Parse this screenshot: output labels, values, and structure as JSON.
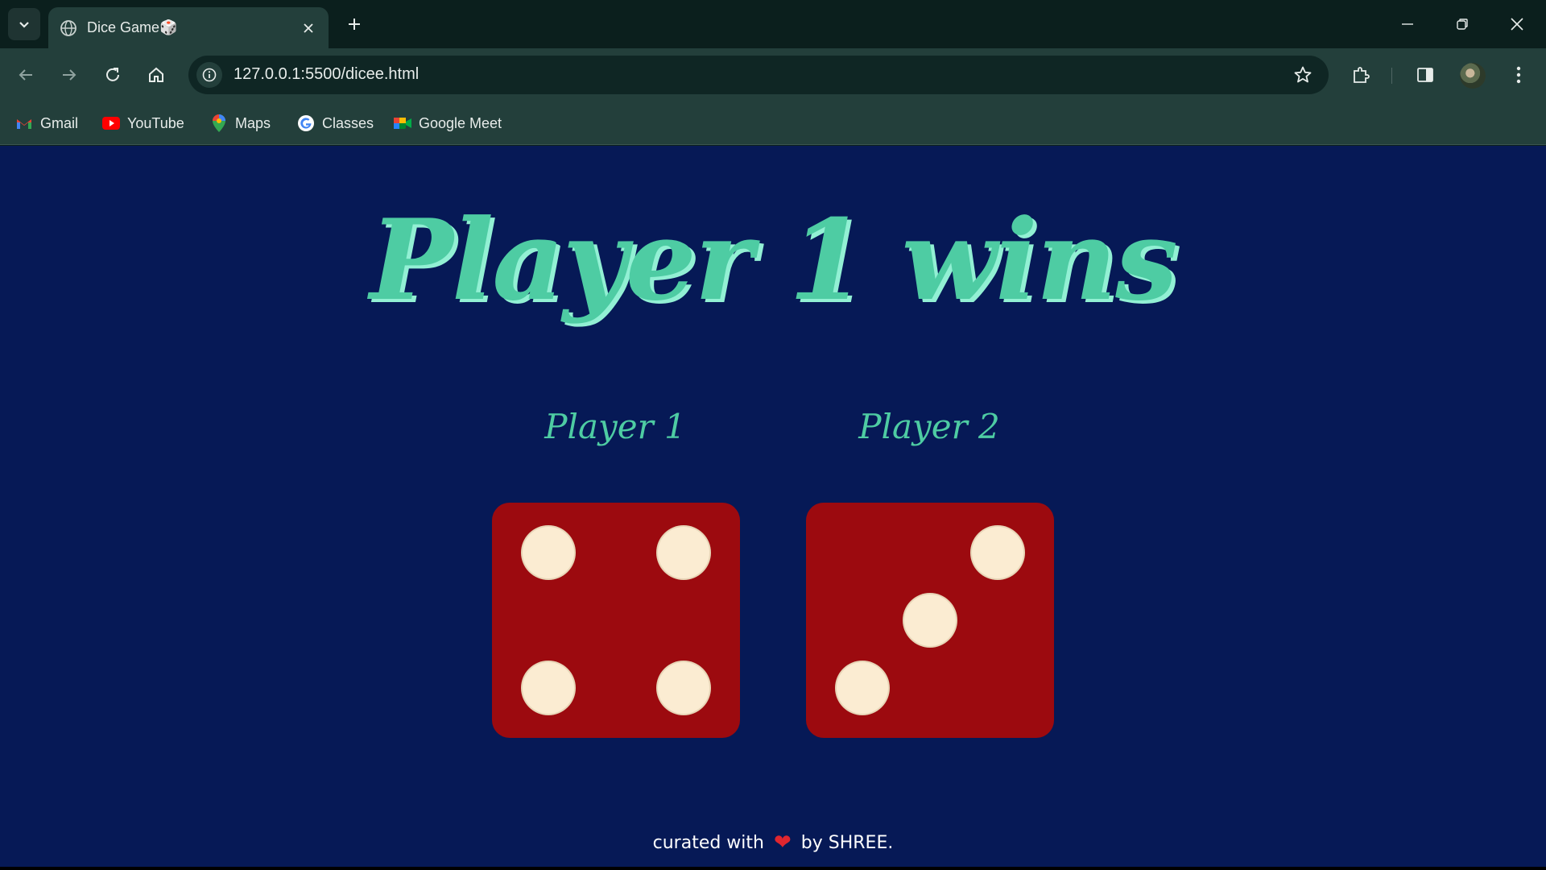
{
  "browser": {
    "tab_title": "Dice Game🎲",
    "url": "127.0.0.1:5500/dicee.html",
    "bookmarks": [
      {
        "label": "Gmail",
        "icon": "gmail-icon"
      },
      {
        "label": "YouTube",
        "icon": "youtube-icon"
      },
      {
        "label": "Maps",
        "icon": "maps-icon"
      },
      {
        "label": "Classes",
        "icon": "google-icon"
      },
      {
        "label": "Google Meet",
        "icon": "meet-icon"
      }
    ]
  },
  "game": {
    "headline": "Player 1 wins",
    "players": [
      {
        "label": "Player 1",
        "die_value": 4
      },
      {
        "label": "Player 2",
        "die_value": 3
      }
    ],
    "footer": {
      "prefix": "curated with",
      "heart": "❤",
      "suffix": "by SHREE."
    }
  },
  "colors": {
    "page_background": "#061956",
    "headline": "#4ecca3",
    "headline_shadow": "#92f0d4",
    "die": "#9c0a0f",
    "pip": "#fbecd2",
    "chrome_dark": "#0b1f1d",
    "chrome_toolbar": "#233f3b"
  }
}
